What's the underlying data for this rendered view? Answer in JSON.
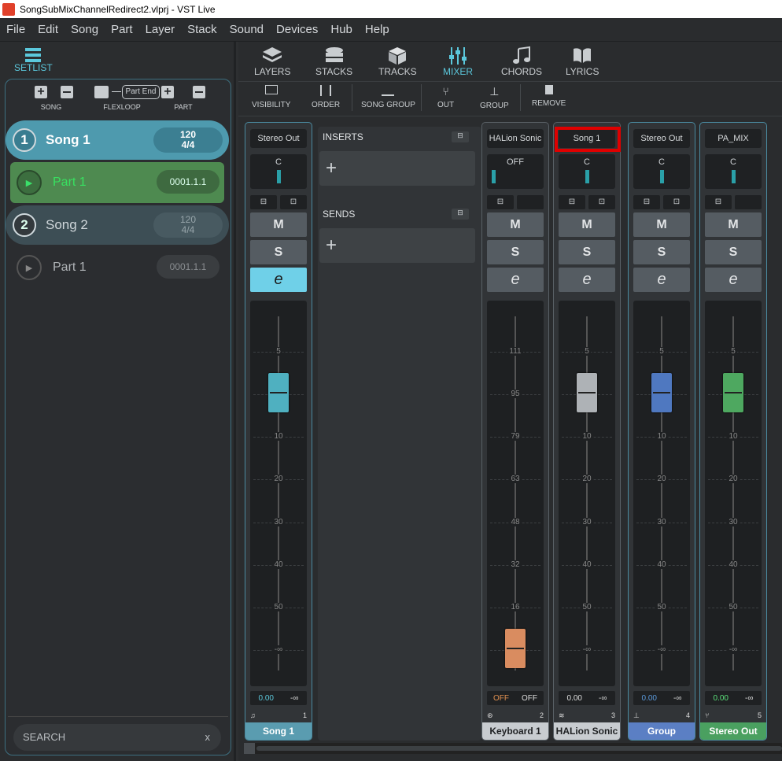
{
  "window": {
    "title": "SongSubMixChannelRedirect2.vlprj - VST Live"
  },
  "menu": [
    "File",
    "Edit",
    "Song",
    "Part",
    "Layer",
    "Stack",
    "Sound",
    "Devices",
    "Hub",
    "Help"
  ],
  "setlist": {
    "tab": "SETLIST",
    "toolbar": {
      "song": "SONG",
      "flexloop": "FLEXLOOP",
      "part_end": "Part End",
      "part": "PART"
    },
    "songs": [
      {
        "num": "1",
        "name": "Song 1",
        "tempo": "120",
        "sig": "4/4",
        "part": {
          "name": "Part  1",
          "pos": "0001.1.1"
        }
      },
      {
        "num": "2",
        "name": "Song 2",
        "tempo": "120",
        "sig": "4/4",
        "part": {
          "name": "Part  1",
          "pos": "0001.1.1"
        }
      }
    ],
    "search": {
      "label": "SEARCH",
      "clear": "x"
    }
  },
  "tabs": [
    "LAYERS",
    "STACKS",
    "TRACKS",
    "MIXER",
    "CHORDS",
    "LYRICS"
  ],
  "active_tab": "MIXER",
  "toolbar": [
    "VISIBILITY",
    "ORDER",
    "SONG GROUP",
    "OUT",
    "GROUP",
    "REMOVE"
  ],
  "inspector": {
    "inserts": "INSERTS",
    "sends": "SENDS",
    "add": "+"
  },
  "strips": [
    {
      "name": "Stereo Out",
      "pan": "C",
      "m": "M",
      "s": "S",
      "e": "e",
      "scale": [
        "5",
        "0",
        "10",
        "20",
        "30",
        "40",
        "50",
        "-∞"
      ],
      "val1": "0.00",
      "val2": "-∞",
      "num": "1",
      "label": "Song 1",
      "color": "#5a9cb0"
    },
    {
      "name": "HALion Sonic",
      "pan": "OFF",
      "m": "M",
      "s": "S",
      "e": "e",
      "scale": [
        "111",
        "95",
        "79",
        "63",
        "48",
        "32",
        "16",
        "0"
      ],
      "val1": "OFF",
      "val2": "OFF",
      "num": "2",
      "label": "Keyboard 1",
      "color": "#c8ccd0"
    },
    {
      "name": "Song 1",
      "pan": "C",
      "m": "M",
      "s": "S",
      "e": "e",
      "scale": [
        "5",
        "0",
        "10",
        "20",
        "30",
        "40",
        "50",
        "-∞"
      ],
      "val1": "0.00",
      "val2": "-∞",
      "num": "3",
      "label": "HALion Sonic",
      "color": "#c8ccd0"
    },
    {
      "name": "Stereo Out",
      "pan": "C",
      "m": "M",
      "s": "S",
      "e": "e",
      "scale": [
        "5",
        "0",
        "10",
        "20",
        "30",
        "40",
        "50",
        "-∞"
      ],
      "val1": "0.00",
      "val2": "-∞",
      "num": "4",
      "label": "Group",
      "color": "#5b7fc4"
    },
    {
      "name": "PA_MIX",
      "pan": "C",
      "m": "M",
      "s": "S",
      "e": "e",
      "scale": [
        "5",
        "0",
        "10",
        "20",
        "30",
        "40",
        "50",
        "-∞"
      ],
      "val1": "0.00",
      "val2": "-∞",
      "num": "5",
      "label": "Stereo Out",
      "color": "#4aa060"
    }
  ],
  "colors": {
    "accent": "#5bc8dc",
    "part_green": "#3aa84a",
    "highlight": "#e00000"
  }
}
